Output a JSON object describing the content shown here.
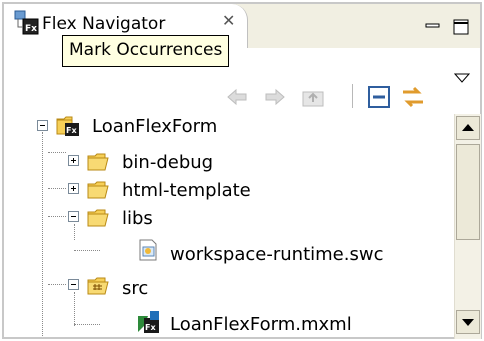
{
  "view": {
    "tab_title": "Flex Navigator",
    "tooltip": "Mark Occurrences"
  },
  "toolbar": {
    "icons": [
      "back-arrow-icon",
      "forward-arrow-icon",
      "up-folder-icon",
      "collapse-all-icon",
      "link-with-editor-icon",
      "view-menu-icon"
    ]
  },
  "tree": {
    "project": "LoanFlexForm",
    "items": [
      {
        "label": "bin-debug"
      },
      {
        "label": "html-template"
      },
      {
        "label": "libs"
      },
      {
        "label": "workspace-runtime.swc"
      },
      {
        "label": "src"
      },
      {
        "label": "LoanFlexForm.mxml"
      }
    ]
  },
  "colors": {
    "tooltip_bg": "#ffffe1",
    "tab_strip_bg": "#f1efe2",
    "folder": "#f6cf57"
  }
}
